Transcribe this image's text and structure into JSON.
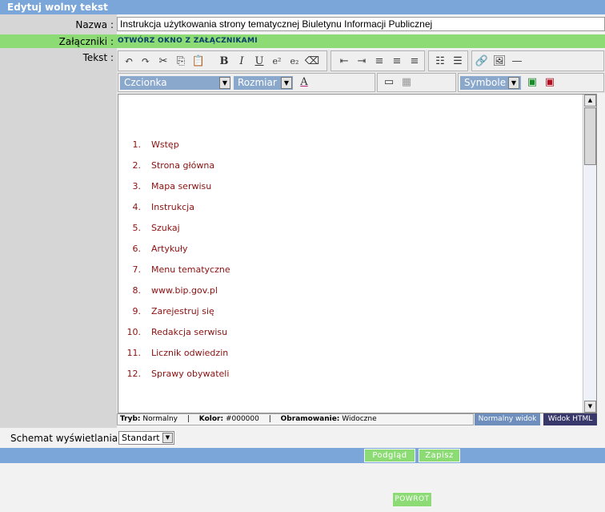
{
  "window": {
    "title": "Edytuj wolny tekst"
  },
  "form": {
    "name_label": "Nazwa :",
    "name_value": "Instrukcja użytkowania strony tematycznej Biuletynu Informacji Publicznej",
    "attachments_label": "Załączniki :",
    "attachments_link": "OTWÓRZ OKNO Z ZAŁĄCZNIKAMI",
    "text_label": "Tekst :"
  },
  "toolbar": {
    "font_select": "Czcionka",
    "size_select": "Rozmiar",
    "symbols_select": "Symbole"
  },
  "editor": {
    "items": [
      {
        "num": "1.",
        "text": "Wstęp"
      },
      {
        "num": "2.",
        "text": "Strona główna"
      },
      {
        "num": "3.",
        "text": "Mapa serwisu"
      },
      {
        "num": "4.",
        "text": "Instrukcja"
      },
      {
        "num": "5.",
        "text": "Szukaj"
      },
      {
        "num": "6.",
        "text": "Artykuły"
      },
      {
        "num": "7.",
        "text": "Menu tematyczne"
      },
      {
        "num": "8.",
        "text": "www.bip.gov.pl"
      },
      {
        "num": "9.",
        "text": "Zarejestruj się"
      },
      {
        "num": "10.",
        "text": "Redakcja serwisu"
      },
      {
        "num": "11.",
        "text": "Licznik odwiedzin"
      },
      {
        "num": "12.",
        "text": "Sprawy obywateli"
      }
    ]
  },
  "status": {
    "mode_label": "Tryb:",
    "mode_value": "Normalny",
    "color_label": "Kolor:",
    "color_value": "#000000",
    "border_label": "Obramowanie:",
    "border_value": "Widoczne",
    "normal_view": "Normalny widok",
    "html_view": "Widok HTML"
  },
  "schema": {
    "label": "Schemat wyświetlania :",
    "value": "Standart"
  },
  "actions": {
    "preview": "Podgląd",
    "save": "Zapisz",
    "back": "POWROT"
  },
  "colors": {
    "titlebar": "#7aa6da",
    "green": "#8cdb75",
    "list_text": "#8b1010",
    "normal_view_bg": "#6e8fbd",
    "html_view_bg": "#38386a"
  }
}
